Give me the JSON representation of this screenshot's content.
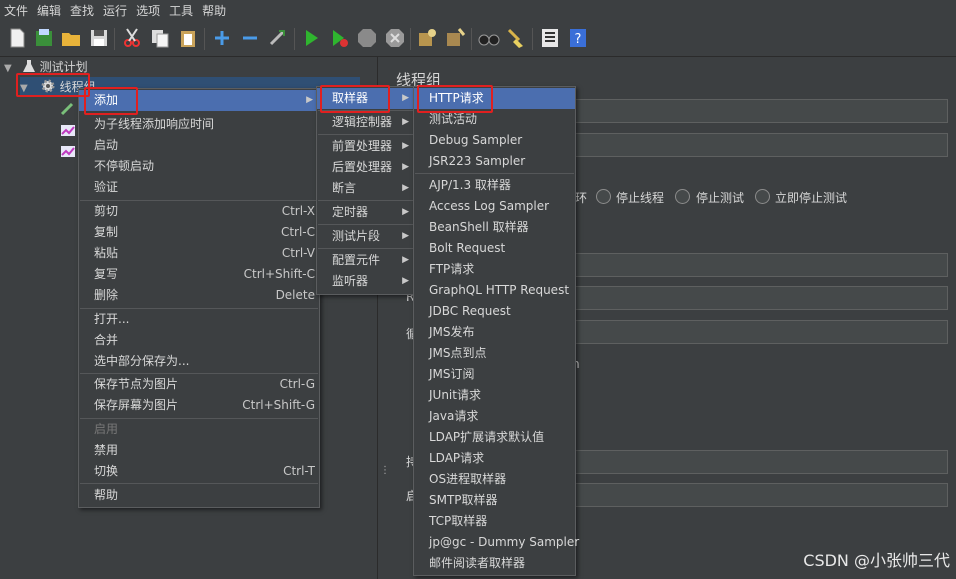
{
  "menubar": [
    "文件",
    "编辑",
    "查找",
    "运行",
    "选项",
    "工具",
    "帮助"
  ],
  "tree": {
    "test_plan": "测试计划",
    "thread_group": "线程组"
  },
  "right_panel": {
    "title": "线程组",
    "radio_options": [
      "停止线程",
      "停止测试",
      "立即停止测试"
    ],
    "partial_chars": {
      "c1": "环",
      "c2": "R",
      "c3": "循",
      "c4": "n",
      "c5": "持",
      "c6": "启"
    }
  },
  "context_menu": {
    "items": [
      {
        "label": "添加",
        "shortcut": "",
        "submenu": true
      },
      {
        "label": "为子线程添加响应时间",
        "shortcut": ""
      },
      {
        "label": "启动",
        "shortcut": ""
      },
      {
        "label": "不停顿启动",
        "shortcut": ""
      },
      {
        "label": "验证",
        "shortcut": ""
      },
      {
        "label": "剪切",
        "shortcut": "Ctrl-X"
      },
      {
        "label": "复制",
        "shortcut": "Ctrl-C"
      },
      {
        "label": "粘贴",
        "shortcut": "Ctrl-V"
      },
      {
        "label": "复写",
        "shortcut": "Ctrl+Shift-C"
      },
      {
        "label": "删除",
        "shortcut": "Delete"
      },
      {
        "label": "打开...",
        "shortcut": ""
      },
      {
        "label": "合并",
        "shortcut": ""
      },
      {
        "label": "选中部分保存为...",
        "shortcut": ""
      },
      {
        "label": "保存节点为图片",
        "shortcut": "Ctrl-G"
      },
      {
        "label": "保存屏幕为图片",
        "shortcut": "Ctrl+Shift-G"
      },
      {
        "label": "启用",
        "shortcut": ""
      },
      {
        "label": "禁用",
        "shortcut": ""
      },
      {
        "label": "切换",
        "shortcut": "Ctrl-T"
      },
      {
        "label": "帮助",
        "shortcut": ""
      }
    ]
  },
  "add_menu": [
    "取样器",
    "逻辑控制器",
    "前置处理器",
    "后置处理器",
    "断言",
    "定时器",
    "测试片段",
    "配置元件",
    "监听器"
  ],
  "sampler_menu": [
    "HTTP请求",
    "测试活动",
    "Debug Sampler",
    "JSR223 Sampler",
    "AJP/1.3 取样器",
    "Access Log Sampler",
    "BeanShell 取样器",
    "Bolt Request",
    "FTP请求",
    "GraphQL HTTP Request",
    "JDBC Request",
    "JMS发布",
    "JMS点到点",
    "JMS订阅",
    "JUnit请求",
    "Java请求",
    "LDAP扩展请求默认值",
    "LDAP请求",
    "OS进程取样器",
    "SMTP取样器",
    "TCP取样器",
    "jp@gc - Dummy Sampler",
    "邮件阅读者取样器"
  ],
  "watermark": "CSDN @小张帅三代",
  "colors": {
    "selection": "#4b6eaf",
    "highlight_box": "#e02020",
    "background": "#3c3f41"
  }
}
